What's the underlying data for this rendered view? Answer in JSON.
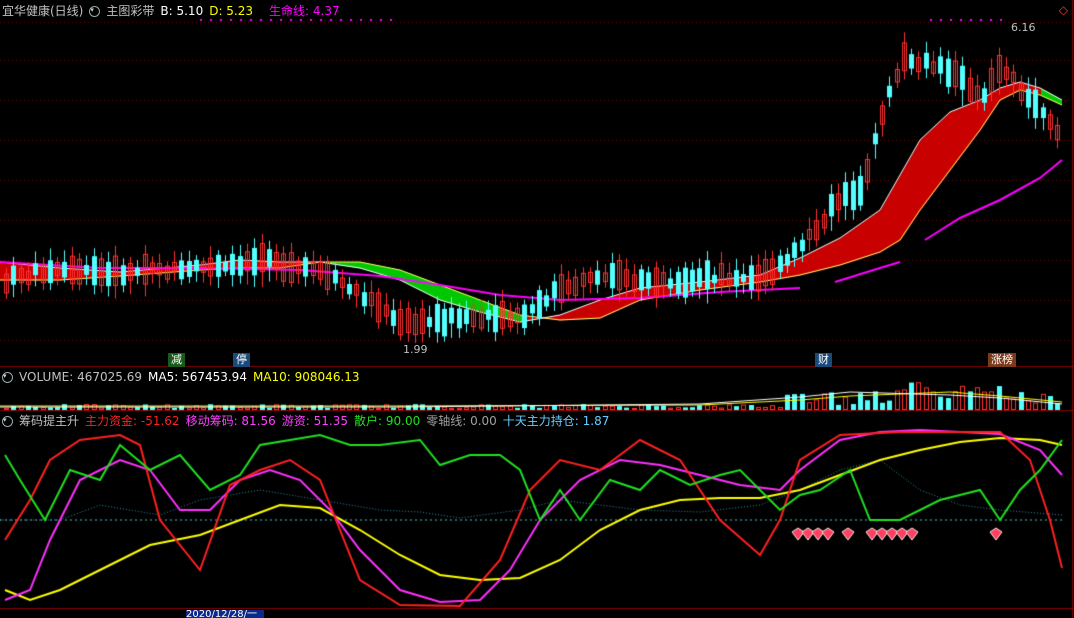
{
  "main_panel": {
    "stock_name": "宜华健康(日线)",
    "indicator_name": "主图彩带",
    "b_label": "B: 5.10",
    "d_label": "D: 5.23",
    "life_label": "生命线: 4.37",
    "high_marker": "6.16",
    "low_marker": "1.99",
    "signal_tags": [
      "减",
      "停",
      "财",
      "涨榜"
    ],
    "colors": {
      "b": "#ffffff",
      "d": "#ffff00",
      "life": "#ff00ff",
      "up": "#ff3030",
      "down": "#54ffff",
      "band_red": "#cc0000",
      "band_green": "#00d000"
    }
  },
  "volume_panel": {
    "label": "VOLUME: 467025.69",
    "ma5": "MA5: 567453.94",
    "ma10": "MA10: 908046.13"
  },
  "chip_panel": {
    "name": "筹码提主升",
    "main_fund": "主力资金: -51.62",
    "moving_chip": "移动筹码: 81.56",
    "hot_money": "游资: 51.35",
    "retail": "散户: 90.00",
    "zero_line": "零轴线: 0.00",
    "ten_day": "十天主力持仓: 1.87",
    "colors": {
      "main_fund": "#ff2020",
      "moving_chip": "#ff40ff",
      "hot_money": "#ffff00",
      "retail": "#20e020",
      "zero_line": "#40c0c0",
      "ten_day": "#66ccff"
    }
  },
  "axis": {
    "date_label": "2020/12/28/一"
  },
  "icons": [
    "settings-circle-icon",
    "diamond-icon"
  ]
}
